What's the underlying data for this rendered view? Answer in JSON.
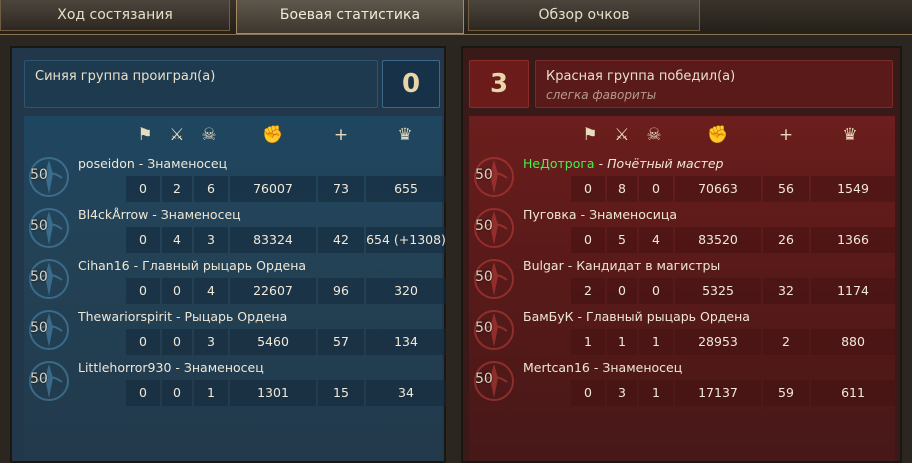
{
  "tabs": [
    {
      "label": "Ход состязания"
    },
    {
      "label": "Боевая статистика"
    },
    {
      "label": "Обзор очков"
    }
  ],
  "blue": {
    "title": "Синяя группа проиграл(а)",
    "subtitle": "",
    "score": "0",
    "players": [
      {
        "level": "50",
        "name": "poseidon",
        "rank": "Знаменосец",
        "stats": [
          "0",
          "2",
          "6",
          "76007",
          "73",
          "655"
        ]
      },
      {
        "level": "50",
        "name": "Bl4ckÅrrow",
        "rank": "Знаменосец",
        "stats": [
          "0",
          "4",
          "3",
          "83324",
          "42",
          "654 (+1308)"
        ]
      },
      {
        "level": "50",
        "name": "Cihan16",
        "rank": "Главный рыцарь Ордена",
        "stats": [
          "0",
          "0",
          "4",
          "22607",
          "96",
          "320"
        ]
      },
      {
        "level": "50",
        "name": "Thewariorspirit",
        "rank": "Рыцарь Ордена",
        "stats": [
          "0",
          "0",
          "3",
          "5460",
          "57",
          "134"
        ]
      },
      {
        "level": "50",
        "name": "Littlehorror930",
        "rank": "Знаменосец",
        "stats": [
          "0",
          "0",
          "1",
          "1301",
          "15",
          "34"
        ]
      }
    ]
  },
  "red": {
    "title": "Красная группа победил(а)",
    "subtitle": "слегка фавориты",
    "score": "3",
    "players": [
      {
        "level": "50",
        "name": "НеДотрога",
        "rank": "Почётный мастер",
        "stats": [
          "0",
          "8",
          "0",
          "70663",
          "56",
          "1549"
        ]
      },
      {
        "level": "50",
        "name": "Пуговка",
        "rank": "Знаменосица",
        "stats": [
          "0",
          "5",
          "4",
          "83520",
          "26",
          "1366"
        ]
      },
      {
        "level": "50",
        "name": "Bulgar",
        "rank": "Кандидат в магистры",
        "stats": [
          "2",
          "0",
          "0",
          "5325",
          "32",
          "1174"
        ]
      },
      {
        "level": "50",
        "name": "БамБуК",
        "rank": "Главный рыцарь Ордена",
        "stats": [
          "1",
          "1",
          "1",
          "28953",
          "2",
          "880"
        ]
      },
      {
        "level": "50",
        "name": "Mertcan16",
        "rank": "Знаменосец",
        "stats": [
          "0",
          "3",
          "1",
          "17137",
          "59",
          "611"
        ]
      }
    ]
  },
  "separator": " - ",
  "columns": [
    {
      "icon": "flag-icon",
      "glyph": "⚑"
    },
    {
      "icon": "crossed-swords-icon",
      "glyph": "⚔"
    },
    {
      "icon": "skull-icon",
      "glyph": "☠"
    },
    {
      "icon": "fist-icon",
      "glyph": "✊"
    },
    {
      "icon": "plus-icon",
      "glyph": "+"
    },
    {
      "icon": "crown-icon",
      "glyph": "♛"
    }
  ],
  "colors": {
    "blue_accent": "#22384a",
    "red_accent": "#3a1a19",
    "highlight_name": "#49f049"
  }
}
